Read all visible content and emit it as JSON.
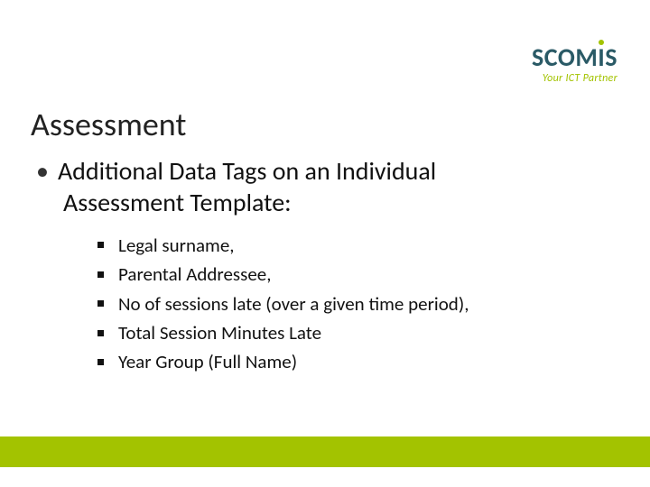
{
  "logo": {
    "text": "SCOMIS",
    "tagline": "Your ICT Partner"
  },
  "title": "Assessment",
  "mainBullet": {
    "line1": "Additional Data Tags on an Individual",
    "line2": "Assessment Template:"
  },
  "subItems": [
    "Legal surname,",
    "Parental Addressee,",
    "No of sessions late (over a given time period),",
    "Total Session Minutes Late",
    "Year Group (Full Name)"
  ]
}
